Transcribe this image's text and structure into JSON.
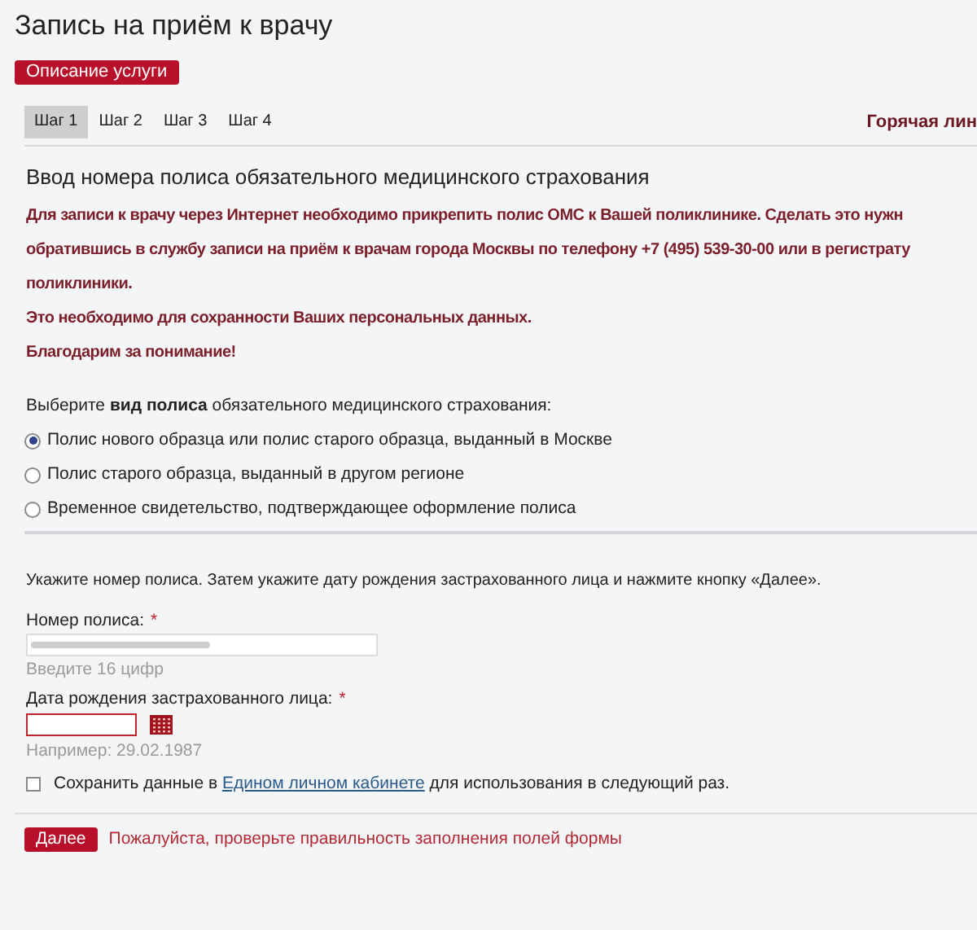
{
  "title": "Запись на приём к врачу",
  "service_button": "Описание услуги",
  "steps": [
    {
      "label": "Шаг 1",
      "selected": true
    },
    {
      "label": "Шаг 2",
      "selected": false
    },
    {
      "label": "Шаг 3",
      "selected": false
    },
    {
      "label": "Шаг 4",
      "selected": false
    }
  ],
  "hotline": "Горячая лин",
  "heading": "Ввод номера полиса обязательного медицинского страхования",
  "notice_lines": [
    "Для записи к врачу через Интернет необходимо прикрепить полис ОМС к Вашей поликлинике. Сделать это нужн",
    "обратившись в службу записи на приём к врачам города Москвы по телефону +7 (495) 539-30-00 или в регистрату",
    "поликлиники.",
    "Это необходимо для сохранности Ваших персональных данных.",
    "Благодарим за понимание!"
  ],
  "policy_type_prompt": "Выберите **вид полиса** обязательного медицинского страхования:",
  "policy_types": [
    {
      "label": "Полис нового образца или полис старого образца, выданный в Москве",
      "selected": true
    },
    {
      "label": "Полис старого образца, выданный в другом регионе",
      "selected": false
    },
    {
      "label": "Временное свидетельство, подтверждающее оформление полиса",
      "selected": false
    }
  ],
  "instruction": "Укажите номер полиса. Затем укажите дату рождения застрахованного лица и нажмите кнопку «Далее».",
  "policy_number": {
    "label": "Номер полиса:",
    "required_mark": "*",
    "blurred": true,
    "hint": "Введите 16 цифр"
  },
  "birth_date": {
    "label": "Дата рождения застрахованного лица:",
    "required_mark": "*",
    "invalid": true,
    "hint": "Например: 29.02.1987"
  },
  "save_option": {
    "before": "Сохранить данные в",
    "link": "Едином личном кабинете",
    "after": "для использования в следующий раз.",
    "checked": false
  },
  "next_button": "Далее",
  "error_message": "Пожалуйста, проверьте правильность заполнения полей формы"
}
